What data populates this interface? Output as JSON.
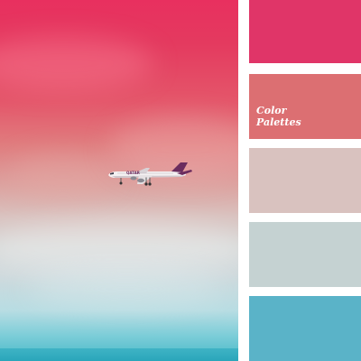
{
  "photo": {
    "description_icon": "airplane-icon",
    "livery_text": "QATAR"
  },
  "palette": {
    "swatches": [
      {
        "name": "swatch-raspberry-pink",
        "color": "#e03568"
      },
      {
        "name": "swatch-coral-rose",
        "color": "#dc6f72"
      },
      {
        "name": "swatch-dusty-pink",
        "color": "#d9c2bf"
      },
      {
        "name": "swatch-pale-grey-blue",
        "color": "#c5d2d2"
      },
      {
        "name": "swatch-sky-turquoise",
        "color": "#5ab3c8"
      }
    ]
  },
  "brand": {
    "line1": "Color",
    "line2": "Palettes"
  }
}
